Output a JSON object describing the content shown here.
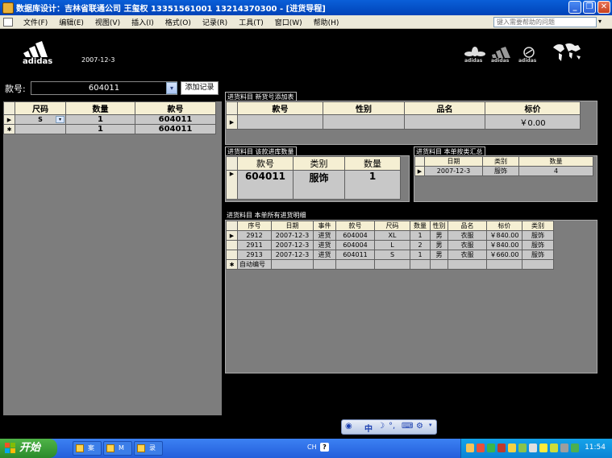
{
  "window": {
    "title": "数据库设计：吉林省联通公司 王玺权 13351561001  13214370300 - [进货导程]",
    "minimize_label": "_",
    "maximize_label": "❐",
    "close_label": "✕"
  },
  "menubar": {
    "items": [
      "文件(F)",
      "编辑(E)",
      "视图(V)",
      "插入(I)",
      "格式(O)",
      "记录(R)",
      "工具(T)",
      "窗口(W)",
      "帮助(H)"
    ],
    "help_placeholder": "键入需要帮助的问题",
    "help_arrow": "▾",
    "close_glyph": "×"
  },
  "banner": {
    "brand": "adidas",
    "date": "2007-12-3",
    "small_logos": [
      "adidas",
      "adidas",
      "adidas"
    ]
  },
  "left": {
    "label": "款号:",
    "combo_value": "604011",
    "combo_arrow": "▾",
    "add_button": "添加记录",
    "grid": {
      "headers": [
        "尺码",
        "数量",
        "款号"
      ],
      "rows": [
        {
          "marker": "▶",
          "size": "S",
          "qty": "1",
          "style": "604011"
        },
        {
          "marker": "✱",
          "size": "",
          "qty": "1",
          "style": "604011"
        }
      ]
    }
  },
  "new_goods": {
    "title": "进货料目 新货号添加表",
    "headers": [
      "款号",
      "性别",
      "品名",
      "标价"
    ],
    "row": {
      "marker": "▶",
      "style": "",
      "gender": "",
      "name": "",
      "price": "￥0.00"
    }
  },
  "stock_qty": {
    "title": "进货料目 该款进库数量",
    "headers": [
      "款号",
      "类别",
      "数量"
    ],
    "row": {
      "marker": "▶",
      "style": "604011",
      "category": "服饰",
      "qty": "1"
    }
  },
  "category_summary": {
    "title": "进货料目 本单按类汇总",
    "headers": [
      "日期",
      "类别",
      "数量"
    ],
    "row": {
      "marker": "▶",
      "date": "2007-12-3",
      "category": "服饰",
      "qty": "4"
    }
  },
  "detail": {
    "title": "进货料目 本单所有进货明细",
    "headers": [
      "序号",
      "日期",
      "事件",
      "款号",
      "尺码",
      "数量",
      "性别",
      "品名",
      "标价",
      "类别"
    ],
    "rows": [
      {
        "marker": "▶",
        "cells": [
          "2912",
          "2007-12-3",
          "进货",
          "604004",
          "XL",
          "1",
          "男",
          "衣服",
          "￥840.00",
          "服饰"
        ]
      },
      {
        "marker": "",
        "cells": [
          "2911",
          "2007-12-3",
          "进货",
          "604004",
          "L",
          "2",
          "男",
          "衣服",
          "￥840.00",
          "服饰"
        ]
      },
      {
        "marker": "",
        "cells": [
          "2913",
          "2007-12-3",
          "进货",
          "604011",
          "S",
          "1",
          "男",
          "衣服",
          "￥660.00",
          "服饰"
        ]
      },
      {
        "marker": "✱",
        "cells": [
          "自动编号",
          "",
          "",
          "",
          "",
          "",
          "",
          "",
          "",
          ""
        ]
      }
    ]
  },
  "ime": {
    "zhong": "中"
  },
  "taskbar": {
    "start": "开始",
    "tasks": [
      "案",
      "M",
      "录"
    ],
    "lang": "CH",
    "help": "?",
    "time": "11:54"
  }
}
